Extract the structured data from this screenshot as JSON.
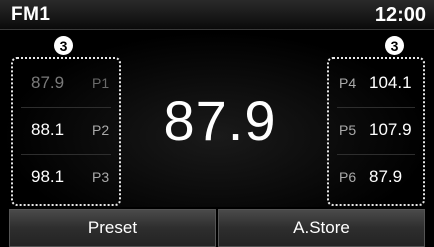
{
  "header": {
    "band": "FM1",
    "clock": "12:00"
  },
  "callouts": {
    "left": "3",
    "right": "3"
  },
  "current_frequency": "87.9",
  "presets_left": [
    {
      "frequency": "87.9",
      "number": "P1",
      "active": true
    },
    {
      "frequency": "88.1",
      "number": "P2",
      "active": false
    },
    {
      "frequency": "98.1",
      "number": "P3",
      "active": false
    }
  ],
  "presets_right": [
    {
      "frequency": "104.1",
      "number": "P4",
      "active": false
    },
    {
      "frequency": "107.9",
      "number": "P5",
      "active": false
    },
    {
      "frequency": "87.9",
      "number": "P6",
      "active": false
    }
  ],
  "buttons": {
    "preset": "Preset",
    "autostore": "A.Store"
  }
}
